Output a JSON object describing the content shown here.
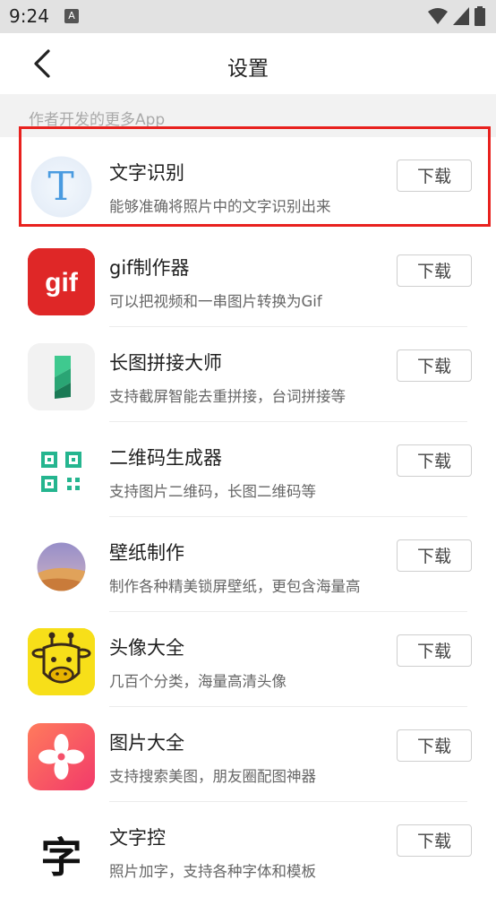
{
  "status": {
    "time": "9:24",
    "notif": "A"
  },
  "header": {
    "title": "设置"
  },
  "section": {
    "label": "作者开发的更多App"
  },
  "apps": [
    {
      "name": "文字识别",
      "desc": "能够准确将照片中的文字识别出来",
      "button": "下载",
      "icon": "text-recognition-icon"
    },
    {
      "name": "gif制作器",
      "desc": "可以把视频和一串图片转换为Gif",
      "button": "下载",
      "icon": "gif-maker-icon",
      "icon_text": "gif"
    },
    {
      "name": "长图拼接大师",
      "desc": "支持截屏智能去重拼接，台词拼接等",
      "button": "下载",
      "icon": "long-image-stitch-icon"
    },
    {
      "name": "二维码生成器",
      "desc": "支持图片二维码，长图二维码等",
      "button": "下载",
      "icon": "qr-code-icon"
    },
    {
      "name": "壁纸制作",
      "desc": "制作各种精美锁屏壁纸，更包含海量高",
      "button": "下载",
      "icon": "wallpaper-icon"
    },
    {
      "name": "头像大全",
      "desc": "几百个分类，海量高清头像",
      "button": "下载",
      "icon": "giraffe-avatar-icon"
    },
    {
      "name": "图片大全",
      "desc": "支持搜索美图，朋友圈配图神器",
      "button": "下载",
      "icon": "flower-icon"
    },
    {
      "name": "文字控",
      "desc": "照片加字，支持各种字体和模板",
      "button": "下载",
      "icon": "text-art-icon",
      "icon_text": "字"
    }
  ],
  "colors": {
    "highlight": "#e8211e",
    "section_bg": "#f2f2f2"
  }
}
